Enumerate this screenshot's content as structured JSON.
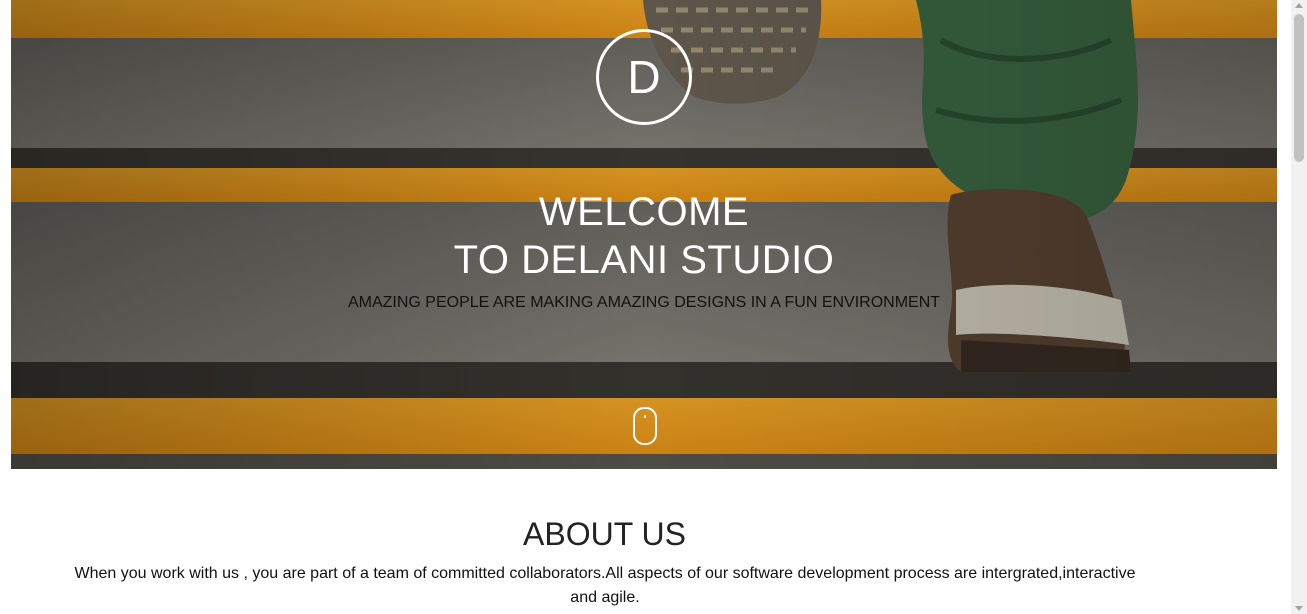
{
  "hero": {
    "logo_letter": "D",
    "welcome_line1": "WELCOME",
    "welcome_line2": "TO DELANI STUDIO",
    "tagline": "AMAZING PEOPLE ARE MAKING AMAZING DESIGNS IN A FUN ENVIRONMENT",
    "scroll_indicator_icon": "mouse-scroll-icon",
    "background_image": "staircase-with-sneaker-photo"
  },
  "about": {
    "title": "ABOUT US",
    "text": "When you work with us , you are part of a team of committed collaborators.All aspects of our software development process are intergrated,interactive and agile."
  },
  "colors": {
    "stair_orange": "#f0a21e",
    "stair_gray": "#7a776f",
    "text_white": "#ffffff",
    "text_dark": "#111111"
  }
}
